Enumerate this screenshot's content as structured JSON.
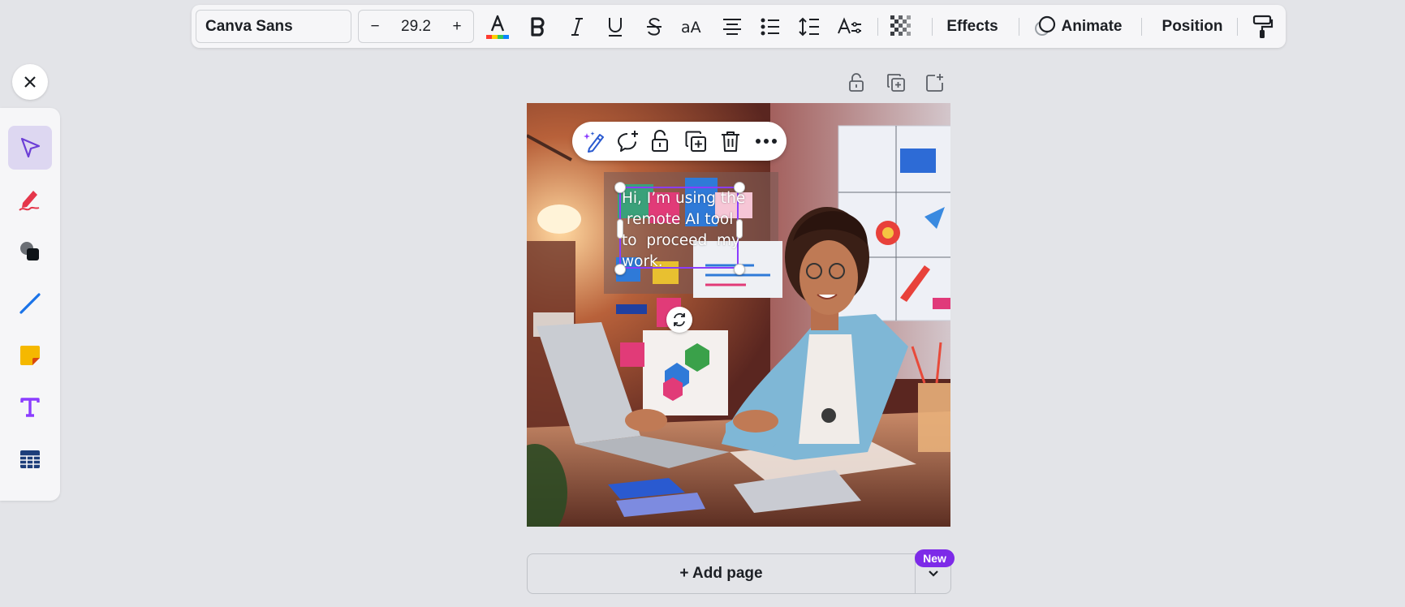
{
  "toolbar": {
    "font_family": "Canva Sans",
    "font_size": "29.2",
    "decrease_label": "−",
    "increase_label": "+",
    "effects_label": "Effects",
    "animate_label": "Animate",
    "position_label": "Position",
    "icons": [
      "text-color-icon",
      "bold-icon",
      "italic-icon",
      "underline-icon",
      "strikethrough-icon",
      "letter-case-icon",
      "align-center-icon",
      "list-icon",
      "spacing-icon",
      "text-style-icon",
      "transparency-icon",
      "animate-icon",
      "copy-style-icon"
    ]
  },
  "left_tools": {
    "items": [
      "select-tool",
      "pen-tool",
      "shapes-tool",
      "line-tool",
      "sticky-note-tool",
      "text-tool",
      "table-tool"
    ],
    "active": "select-tool"
  },
  "page_actions": [
    "lock-icon",
    "duplicate-icon",
    "add-icon"
  ],
  "element_toolbar": [
    "magic-edit-icon",
    "comment-icon",
    "lock-icon",
    "duplicate-icon",
    "delete-icon",
    "more-icon"
  ],
  "textbox": {
    "lines": [
      "Hi, I’m using the",
      " remote AI tool",
      "to  proceed  my",
      "work."
    ]
  },
  "add_page": {
    "label": "+ Add page",
    "badge": "New"
  },
  "colors": {
    "accent": "#8b3dff",
    "badge": "#7d2ae8",
    "background": "#e3e4e8"
  }
}
